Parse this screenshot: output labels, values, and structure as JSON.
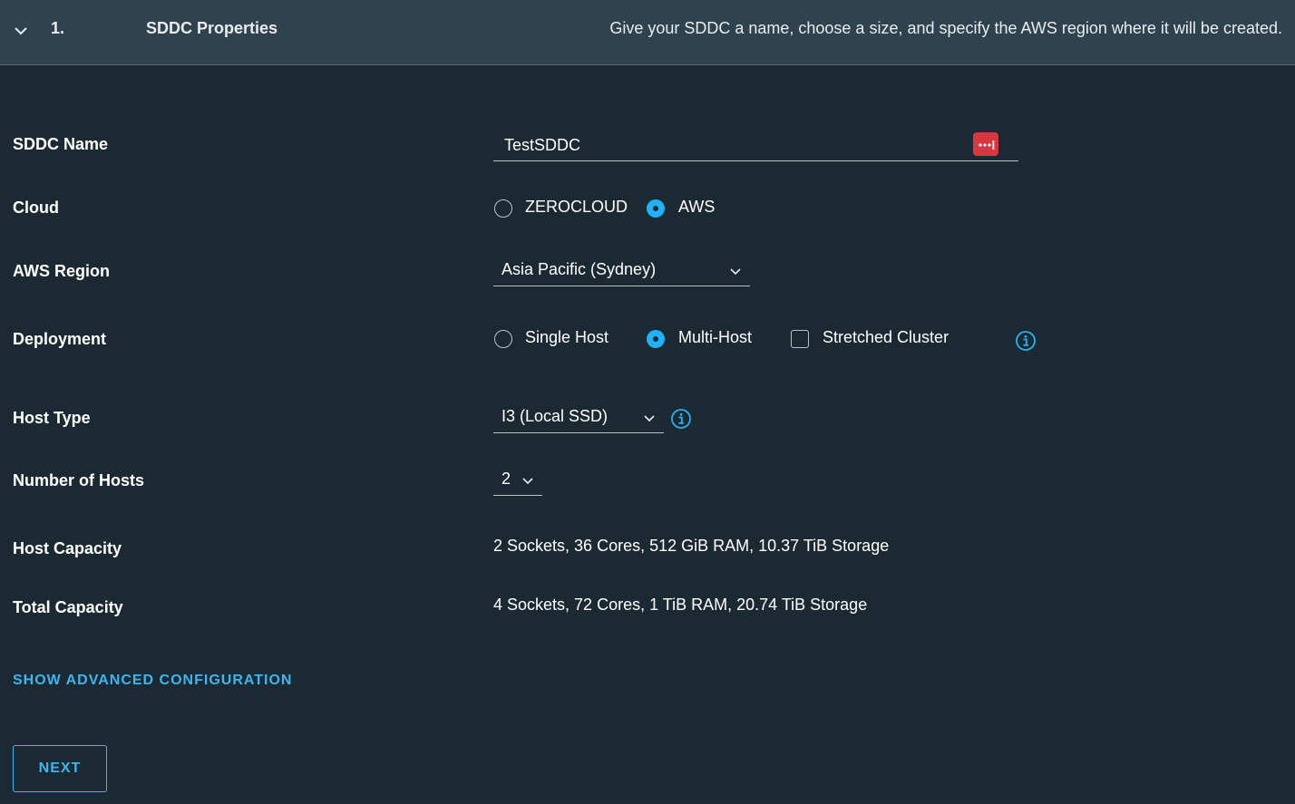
{
  "header": {
    "step_number": "1.",
    "step_title": "SDDC Properties",
    "step_description": "Give your SDDC a name, choose a size, and specify the AWS region where it will be created."
  },
  "form": {
    "sddc_name": {
      "label": "SDDC Name",
      "value": "TestSDDC"
    },
    "cloud": {
      "label": "Cloud",
      "options": [
        {
          "label": "ZEROCLOUD",
          "checked": false
        },
        {
          "label": "AWS",
          "checked": true
        }
      ]
    },
    "aws_region": {
      "label": "AWS Region",
      "selected": "Asia Pacific (Sydney)"
    },
    "deployment": {
      "label": "Deployment",
      "options": [
        {
          "label": "Single Host",
          "checked": false
        },
        {
          "label": "Multi-Host",
          "checked": true
        }
      ],
      "stretched_cluster": {
        "label": "Stretched Cluster",
        "checked": false
      }
    },
    "host_type": {
      "label": "Host Type",
      "selected": "I3 (Local SSD)"
    },
    "number_of_hosts": {
      "label": "Number of Hosts",
      "selected": "2"
    },
    "host_capacity": {
      "label": "Host Capacity",
      "value": "2 Sockets, 36 Cores, 512 GiB RAM, 10.37 TiB Storage"
    },
    "total_capacity": {
      "label": "Total Capacity",
      "value": "4 Sockets, 72 Cores, 1 TiB RAM, 20.74 TiB Storage"
    }
  },
  "advanced_link": "SHOW ADVANCED CONFIGURATION",
  "next_button": "NEXT",
  "icons": {
    "collapse": "chevron-down-icon",
    "password_manager": "password-manager-icon",
    "info": "info-icon",
    "dropdown": "chevron-down-icon"
  },
  "colors": {
    "background": "#1b2a32",
    "header_background": "#2e434d",
    "accent": "#1fb2f6",
    "link": "#3ab6f0",
    "password_badge": "#d7373f"
  }
}
